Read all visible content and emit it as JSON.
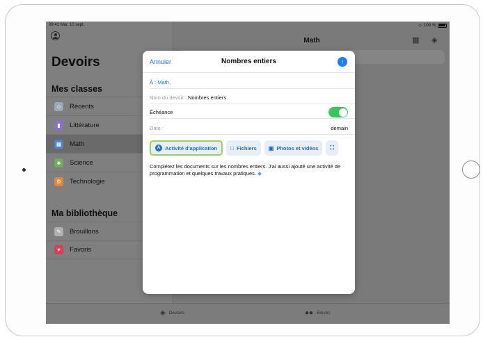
{
  "status_bar": {
    "time": "09:41",
    "date": "Mar. 10 sept.",
    "battery": "100 %"
  },
  "sidebar": {
    "title": "Devoirs",
    "section_classes": "Mes classes",
    "classes": [
      {
        "label": "Récents",
        "icon": "stack-icon",
        "color": "#9aa8b8"
      },
      {
        "label": "Littérature",
        "icon": "book-icon",
        "color": "#8b6fd6"
      },
      {
        "label": "Math",
        "icon": "calculator-icon",
        "color": "#4a86c8"
      },
      {
        "label": "Science",
        "icon": "plant-icon",
        "color": "#6fae57"
      },
      {
        "label": "Technologie",
        "icon": "gear-icon",
        "color": "#e0883a"
      }
    ],
    "section_library": "Ma bibliothèque",
    "library": [
      {
        "label": "Brouillons",
        "icon": "draft-icon",
        "color": "#b0b0b0"
      },
      {
        "label": "Favoris",
        "icon": "heart-icon",
        "color": "#e23a4e"
      }
    ]
  },
  "main": {
    "title": "Math"
  },
  "tabbar": {
    "tab1": "Devoirs",
    "tab2": "Élèves"
  },
  "modal": {
    "cancel": "Annuler",
    "title": "Nombres entiers",
    "to_label": "À :",
    "to_value": "Math,",
    "name_label": "Nom du devoir :",
    "name_value": "Nombres entiers",
    "due_label": "Échéance",
    "due_enabled": true,
    "date_label": "Date :",
    "date_value": "demain",
    "chips": {
      "app_activity": "Activité d'application",
      "files": "Fichiers",
      "photos": "Photos et vidéos"
    },
    "body": "Complétez les documents sur les nombres entiers. J'ai aussi ajouté une activité de programmation et quelques travaux pratiques."
  },
  "colors": {
    "accent": "#1a73e8",
    "toggle_on": "#34c759",
    "highlight": "#9bd64d"
  }
}
